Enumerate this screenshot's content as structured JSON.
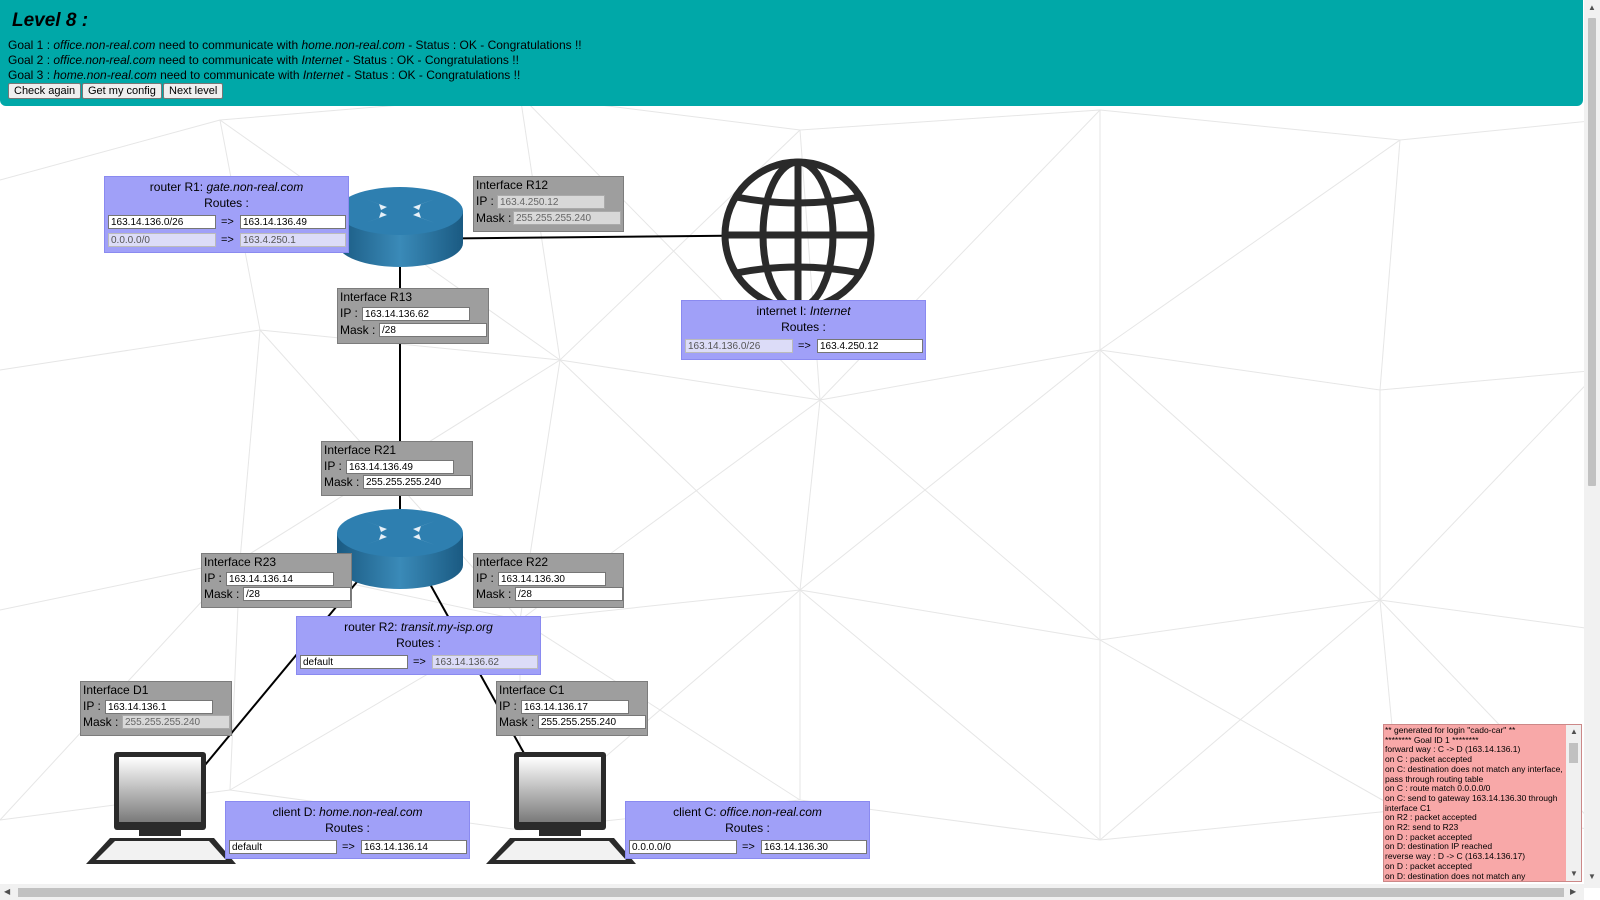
{
  "header": {
    "title": "Level 8 :",
    "goals": [
      {
        "prefix": "Goal 1 : ",
        "src": "office.non-real.com",
        "mid": " need to communicate with ",
        "dst": "home.non-real.com",
        "status": " - Status : OK - Congratulations !!"
      },
      {
        "prefix": "Goal 2 : ",
        "src": "office.non-real.com",
        "mid": " need to communicate with ",
        "dst": "Internet",
        "status": " - Status : OK - Congratulations !!"
      },
      {
        "prefix": "Goal 3 : ",
        "src": "home.non-real.com",
        "mid": " need to communicate with ",
        "dst": "Internet",
        "status": " - Status : OK - Congratulations !!"
      }
    ],
    "buttons": {
      "check": "Check again",
      "config": "Get my config",
      "next": "Next level"
    }
  },
  "labels": {
    "routes": "Routes :",
    "ip": "IP :",
    "mask": "Mask :",
    "arrow": "=>"
  },
  "routers": {
    "r1": {
      "prefix": "router R1: ",
      "host": "gate.non-real.com",
      "routes": [
        {
          "dest": "163.14.136.0/26",
          "gw": "163.14.136.49"
        },
        {
          "dest": "0.0.0.0/0",
          "gw": "163.4.250.1"
        }
      ]
    },
    "r2": {
      "prefix": "router R2: ",
      "host": "transit.my-isp.org",
      "routes": [
        {
          "dest": "default",
          "gw": "163.14.136.62"
        }
      ]
    }
  },
  "internet": {
    "prefix": "internet I: ",
    "host": "Internet",
    "routes": [
      {
        "dest": "163.14.136.0/26",
        "gw": "163.4.250.12"
      }
    ]
  },
  "clients": {
    "d": {
      "prefix": "client D: ",
      "host": "home.non-real.com",
      "routes": [
        {
          "dest": "default",
          "gw": "163.14.136.14"
        }
      ]
    },
    "c": {
      "prefix": "client C: ",
      "host": "office.non-real.com",
      "routes": [
        {
          "dest": "0.0.0.0/0",
          "gw": "163.14.136.30"
        }
      ]
    }
  },
  "interfaces": {
    "r12": {
      "name": "Interface R12",
      "ip": "163.4.250.12",
      "mask": "255.255.255.240"
    },
    "r13": {
      "name": "Interface R13",
      "ip": "163.14.136.62",
      "mask": "/28"
    },
    "r21": {
      "name": "Interface R21",
      "ip": "163.14.136.49",
      "mask": "255.255.255.240"
    },
    "r23": {
      "name": "Interface R23",
      "ip": "163.14.136.14",
      "mask": "/28"
    },
    "r22": {
      "name": "Interface R22",
      "ip": "163.14.136.30",
      "mask": "/28"
    },
    "d1": {
      "name": "Interface D1",
      "ip": "163.14.136.1",
      "mask": "255.255.255.240"
    },
    "c1": {
      "name": "Interface C1",
      "ip": "163.14.136.17",
      "mask": "255.255.255.240"
    }
  },
  "log": {
    "lines": "** generated for login \"cado-car\" **\n******** Goal ID 1 ********\nforward way : C -> D (163.14.136.1)\non C : packet accepted\non C: destination does not match any interface, pass through routing table\non C : route match 0.0.0.0/0\non C: send to gateway 163.14.136.30 through interface C1\non R2 : packet accepted\non R2: send to R23\non D : packet accepted\non D: destination IP reached\nreverse way : D -> C (163.14.136.17)\non D : packet accepted\non D: destination does not match any"
  },
  "colors": {
    "header": "#00a8a8",
    "box": "#a0a0f8",
    "iface": "#9e9e9e",
    "log": "#f8a8a8"
  }
}
